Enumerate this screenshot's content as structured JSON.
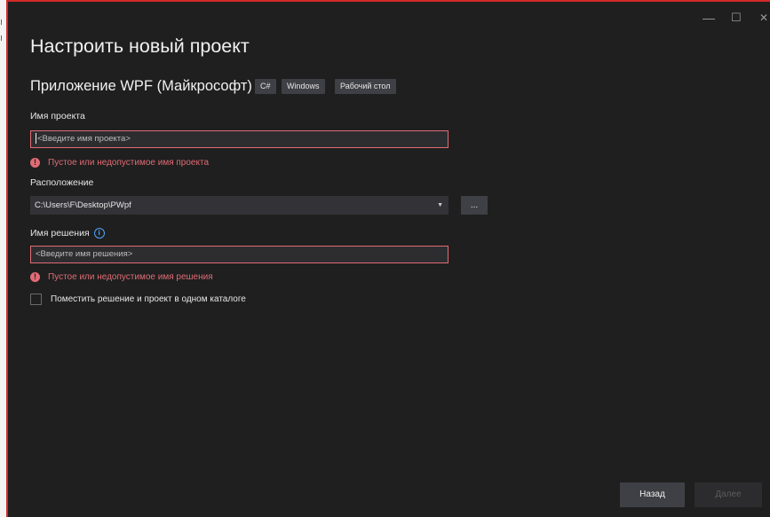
{
  "window": {
    "minimize_glyph": "—",
    "maximize_glyph": "☐",
    "close_glyph": "✕"
  },
  "page_title": "Настроить новый проект",
  "template": {
    "name": "Приложение WPF (Майкрософт)",
    "tags": [
      "C#",
      "Windows",
      "Рабочий стол"
    ]
  },
  "project_name": {
    "label": "Имя проекта",
    "placeholder": "<Введите имя проекта>",
    "error": "Пустое или недопустимое имя проекта"
  },
  "location": {
    "label": "Расположение",
    "value": "C:\\Users\\F\\Desktop\\PWpf",
    "browse_label": "..."
  },
  "solution_name": {
    "label": "Имя решения",
    "placeholder": "<Введите имя решения>",
    "error": "Пустое или недопустимое имя решения"
  },
  "same_dir_checkbox": {
    "label": "Поместить решение и проект в одном каталоге",
    "checked": false
  },
  "footer": {
    "back_label": "Назад",
    "next_label": "Далее"
  },
  "colors": {
    "background": "#1f1f1f",
    "error": "#e06c75",
    "info": "#4fa3ff",
    "frame": "#d42a2a"
  }
}
